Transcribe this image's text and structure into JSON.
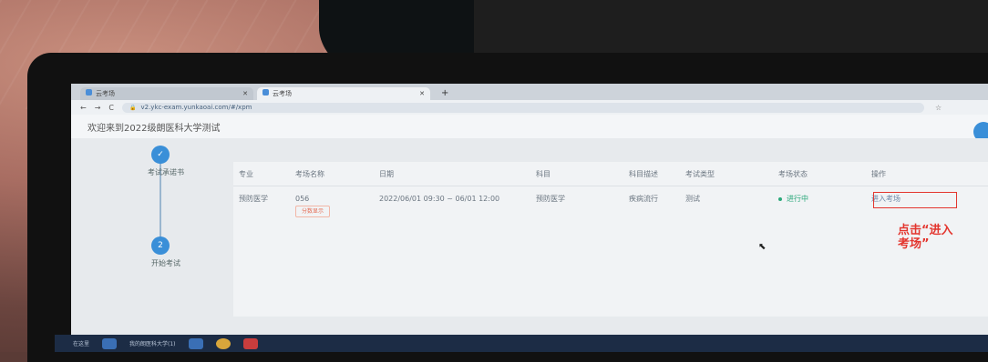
{
  "browser": {
    "tabs": [
      {
        "label": "云考场",
        "active": false
      },
      {
        "label": "云考场",
        "active": true
      }
    ],
    "new_tab": "+",
    "url": "v2.ykc-exam.yunkaoai.com/#/xpm"
  },
  "page": {
    "header_title": "欢迎来到2022级朗医科大学测试"
  },
  "steps": [
    {
      "number": "✓",
      "label": "考试承诺书"
    },
    {
      "number": "2",
      "label": "开始考试"
    }
  ],
  "table": {
    "columns": [
      "专业",
      "考场名称",
      "日期",
      "科目",
      "科目描述",
      "考试类型",
      "考场状态",
      "操作"
    ],
    "rows": [
      {
        "major": "预防医学",
        "room": "056",
        "room_tag": "分数显示",
        "date": "2022/06/01 09:30 ~ 06/01 12:00",
        "subject": "预防医学",
        "subject_desc": "疾病流行",
        "exam_type": "测试",
        "status": "进行中",
        "action": "进入考场"
      }
    ]
  },
  "annotation": {
    "text": "点击“进入\n考场”",
    "color": "#e3352e"
  },
  "taskbar": {
    "search_text": "在这里",
    "app_text": "我的朗医科大学(1)"
  },
  "colors": {
    "accent": "#3a8fd8",
    "status_green": "#2aa87a",
    "annotation_red": "#e3352e"
  }
}
